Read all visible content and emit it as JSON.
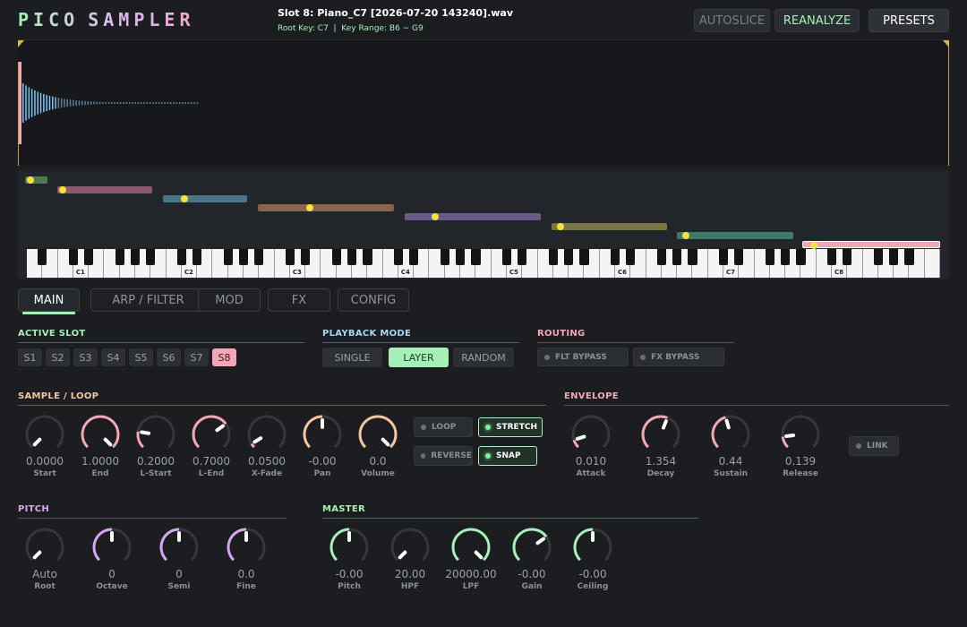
{
  "app": {
    "logo": "PICO SAMPLER",
    "slot_title": "Slot 8: Piano_C7 [2026-07-20 143240].wav",
    "slot_sub": "Root Key: C7  |  Key Range: B6 ~ G9"
  },
  "header_buttons": {
    "autoslice": "AUTOSLICE",
    "reanalyze": "REANALYZE",
    "presets": "PRESETS"
  },
  "keyboard": {
    "octave_labels": [
      "C1",
      "C2",
      "C3",
      "C4",
      "C5",
      "C6",
      "C7",
      "C8"
    ]
  },
  "tabs": [
    {
      "label": "MAIN",
      "active": true
    },
    {
      "label": "ARP / FILTER",
      "active": false
    },
    {
      "label": "MOD",
      "active": false
    },
    {
      "label": "FX",
      "active": false
    },
    {
      "label": "CONFIG",
      "active": false
    }
  ],
  "active_slot": {
    "title": "ACTIVE SLOT",
    "slots": [
      "S1",
      "S2",
      "S3",
      "S4",
      "S5",
      "S6",
      "S7",
      "S8"
    ],
    "selected": "S8"
  },
  "playback_mode": {
    "title": "PLAYBACK MODE",
    "options": [
      "SINGLE",
      "LAYER",
      "RANDOM"
    ],
    "selected": "LAYER"
  },
  "routing": {
    "title": "ROUTING",
    "flt_bypass": "FLT BYPASS",
    "fx_bypass": "FX BYPASS"
  },
  "sample_loop": {
    "title": "SAMPLE / LOOP",
    "knobs": [
      {
        "value": "0.0000",
        "label": "Start"
      },
      {
        "value": "1.0000",
        "label": "End"
      },
      {
        "value": "0.2000",
        "label": "L-Start"
      },
      {
        "value": "0.7000",
        "label": "L-End"
      },
      {
        "value": "0.0500",
        "label": "X-Fade"
      },
      {
        "value": "-0.00",
        "label": "Pan"
      },
      {
        "value": "0.0",
        "label": "Volume"
      }
    ],
    "toggles": {
      "loop": "LOOP",
      "reverse": "REVERSE",
      "stretch": "STRETCH",
      "snap": "SNAP"
    }
  },
  "envelope": {
    "title": "ENVELOPE",
    "knobs": [
      {
        "value": "0.010",
        "label": "Attack"
      },
      {
        "value": "1.354",
        "label": "Decay"
      },
      {
        "value": "0.44",
        "label": "Sustain"
      },
      {
        "value": "0.139",
        "label": "Release"
      }
    ],
    "link": "LINK"
  },
  "pitch": {
    "title": "PITCH",
    "knobs": [
      {
        "value": "Auto",
        "label": "Root"
      },
      {
        "value": "0",
        "label": "Octave"
      },
      {
        "value": "0",
        "label": "Semi"
      },
      {
        "value": "0.0",
        "label": "Fine"
      }
    ]
  },
  "master": {
    "title": "MASTER",
    "knobs": [
      {
        "value": "-0.00",
        "label": "Pitch"
      },
      {
        "value": "20.00",
        "label": "HPF"
      },
      {
        "value": "20000.00",
        "label": "LPF"
      },
      {
        "value": "-0.00",
        "label": "Gain"
      },
      {
        "value": "-0.00",
        "label": "Ceiling"
      }
    ]
  },
  "colors": {
    "accent_green": "#a6f0b8",
    "accent_pink": "#f4a6b6",
    "accent_blue": "#a6d8f0",
    "accent_purple": "#d6a6f4",
    "accent_orange": "#f4c6a0",
    "zone_colors": [
      "#4e7a52",
      "#8a5a6a",
      "#4a7788",
      "#8a6450",
      "#6a5a8a",
      "#7a7442",
      "#3f7a66",
      "#f4a6b6"
    ]
  }
}
